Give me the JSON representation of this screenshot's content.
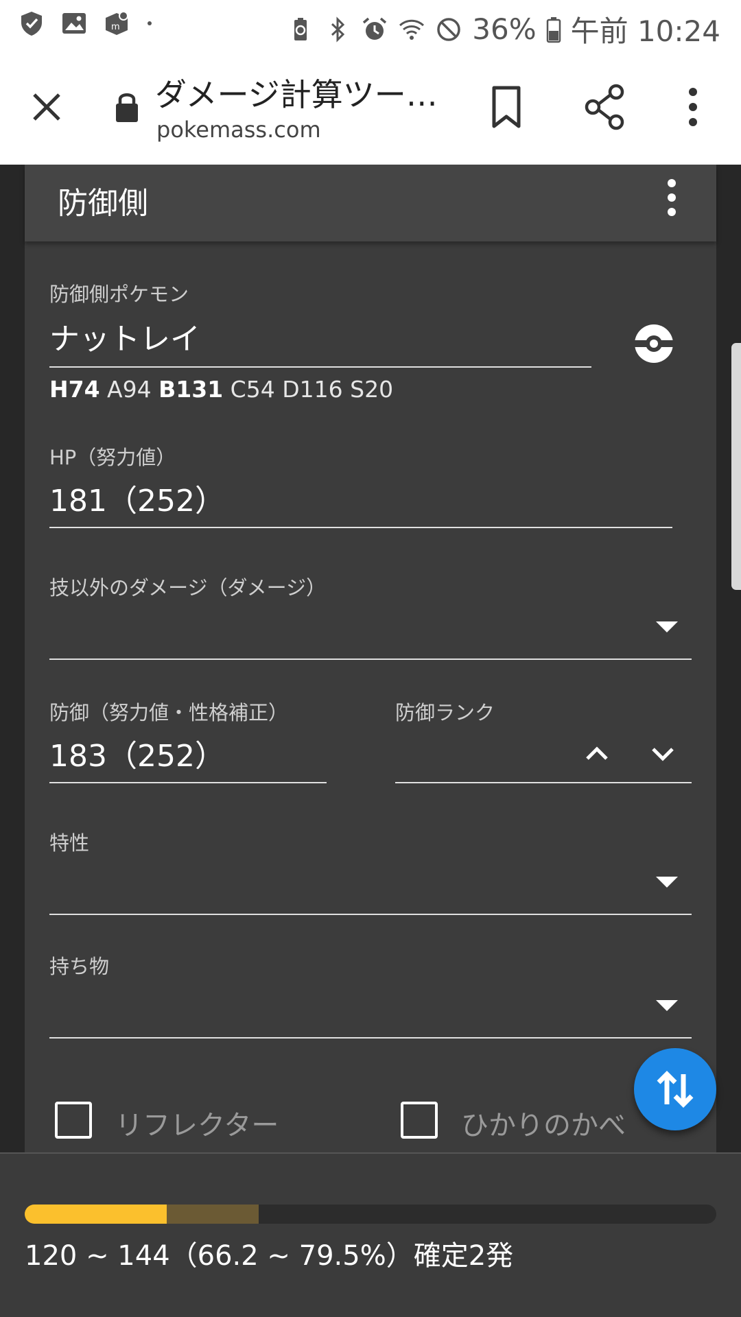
{
  "status_bar": {
    "battery_percent": "36%",
    "time": "午前 10:24",
    "left_icons": [
      "shield-icon",
      "image-icon",
      "app-icon",
      "dot-icon"
    ],
    "right_icons": [
      "battery-saver-icon",
      "bluetooth-icon",
      "alarm-icon",
      "wifi-icon",
      "do-not-disturb-icon",
      "battery-icon"
    ]
  },
  "browser": {
    "title": "ダメージ計算ツー…",
    "url": "pokemass.com"
  },
  "defender": {
    "header": "防御側",
    "pokemon_label": "防御側ポケモン",
    "pokemon_value": "ナットレイ",
    "stats": [
      {
        "text": "H74",
        "bold": true
      },
      {
        "text": "A94",
        "bold": false
      },
      {
        "text": "B131",
        "bold": true
      },
      {
        "text": "C54",
        "bold": false
      },
      {
        "text": "D116",
        "bold": false
      },
      {
        "text": "S20",
        "bold": false
      }
    ],
    "hp_label": "HP（努力値）",
    "hp_value": "181（252）",
    "other_damage_label": "技以外のダメージ（ダメージ）",
    "other_damage_value": "",
    "defense_label": "防御（努力値・性格補正）",
    "defense_value": "183（252）",
    "defense_rank_label": "防御ランク",
    "defense_rank_value": "",
    "ability_label": "特性",
    "ability_value": "",
    "item_label": "持ち物",
    "item_value": "",
    "reflect_label": "リフレクター",
    "reflect_checked": false,
    "light_screen_label": "ひかりのかべ",
    "light_screen_checked": false
  },
  "result": {
    "text": "120 ~ 144（66.2 ~ 79.5%）確定2発",
    "min_percent": 20.5,
    "max_percent": 33.8
  },
  "colors": {
    "accent_blue": "#1e88e5",
    "bar_min": "#fbc02d",
    "bar_max": "#6b5a34",
    "card_bg": "#3c3c3c"
  }
}
